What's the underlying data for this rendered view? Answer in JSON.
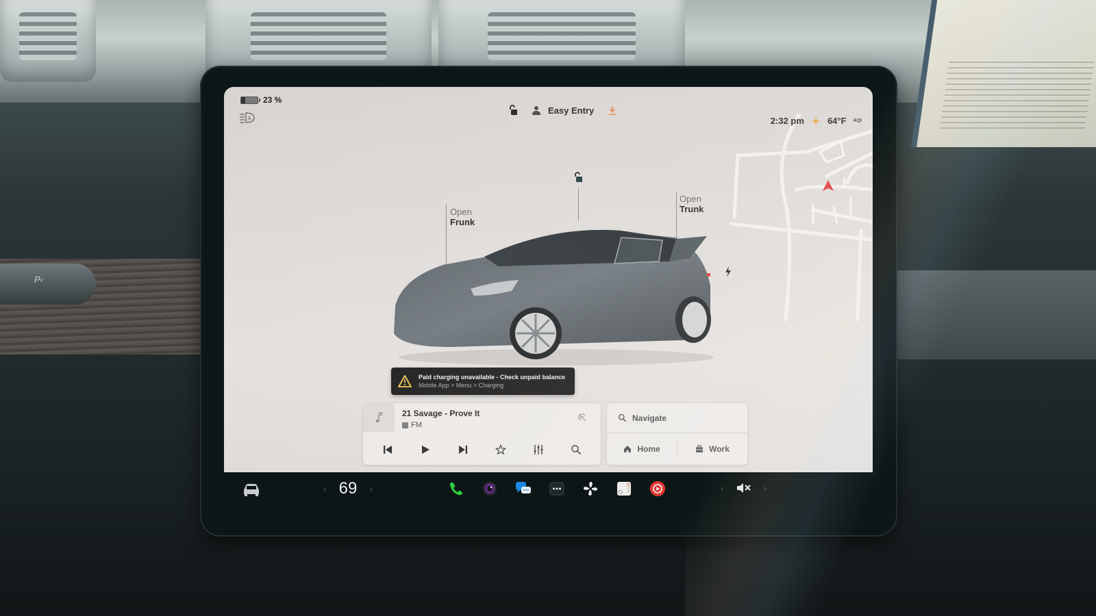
{
  "status": {
    "battery_percent_value": 23,
    "battery_label": "23 %",
    "profile_name": "Easy Entry",
    "time": "2:32 pm",
    "temperature": "64°F",
    "aqi_label": "AQI"
  },
  "icons": {
    "battery": "battery-icon",
    "headlights": "auto-headlights-icon",
    "lock": "unlocked-padlock-icon",
    "profile": "person-icon",
    "download": "download-icon",
    "weather": "sun-icon",
    "nav_arrow": "navigation-arrow-icon",
    "charge_port": "lightning-bolt-icon"
  },
  "vehicle": {
    "frunk": {
      "top": "Open",
      "bottom": "Frunk"
    },
    "trunk": {
      "top": "Open",
      "bottom": "Trunk"
    }
  },
  "alert": {
    "title": "Paid charging unavailable - Check unpaid balance",
    "subtitle": "Mobile App > Menu > Charging",
    "color": "#f2c94c"
  },
  "media": {
    "track": "21 Savage - Prove It",
    "source": "FM",
    "controls": [
      "previous",
      "play",
      "next",
      "favorite",
      "equalizer",
      "search"
    ]
  },
  "navigation": {
    "placeholder": "Navigate",
    "shortcuts": [
      {
        "label": "Home",
        "icon": "home-icon"
      },
      {
        "label": "Work",
        "icon": "briefcase-icon"
      }
    ]
  },
  "dock": {
    "cabin_temp": "69",
    "apps": [
      {
        "name": "phone",
        "color": "#2ecc40"
      },
      {
        "name": "camera",
        "color": "#8e44ad"
      },
      {
        "name": "messages",
        "color": "#1e88e5"
      },
      {
        "name": "more",
        "color": "#2b3435"
      },
      {
        "name": "fan",
        "color": "#ffffff"
      },
      {
        "name": "toybox",
        "color": "#f0eeea"
      },
      {
        "name": "youtube-music",
        "color": "#e53935"
      }
    ],
    "volume_state": "muted"
  },
  "colors": {
    "accent_orange": "#e8803a",
    "nav_arrow_red": "#e03030"
  }
}
